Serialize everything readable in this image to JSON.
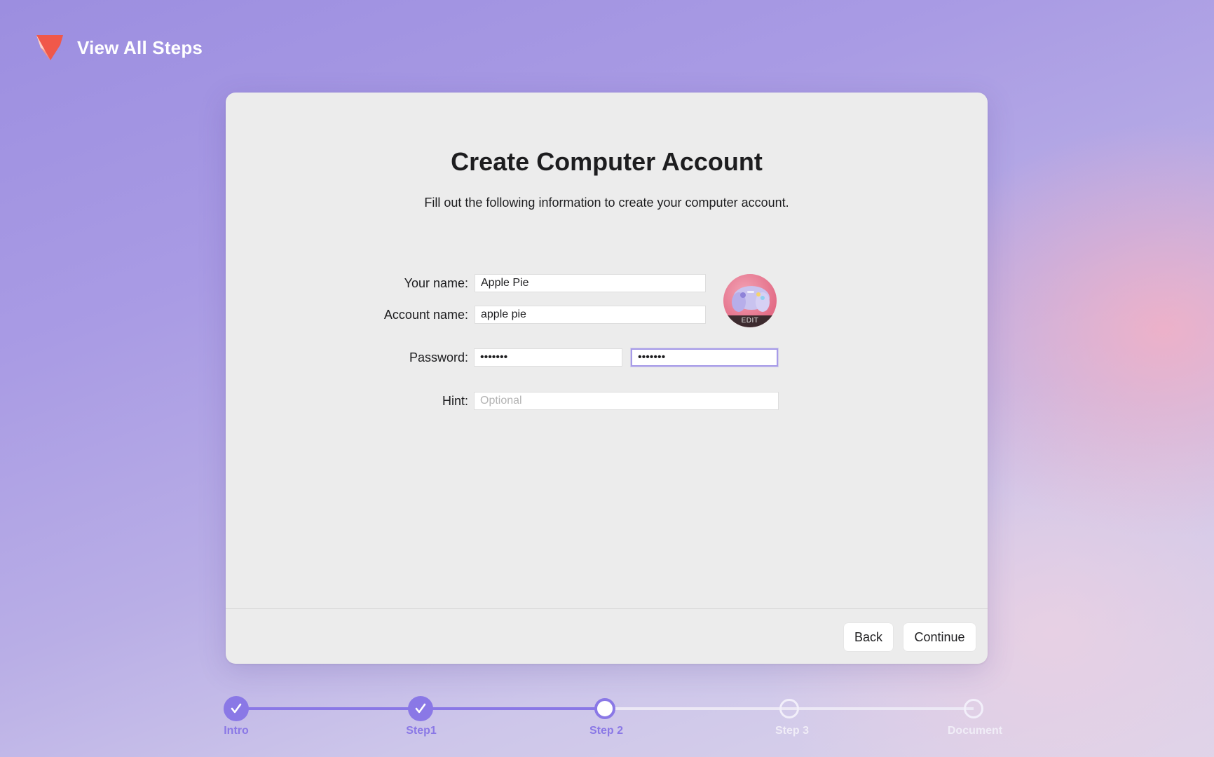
{
  "header": {
    "title": "View All Steps",
    "logo_icon": "folded-ribbon-logo-icon",
    "logo_color": "#f0584a"
  },
  "dialog": {
    "title": "Create Computer Account",
    "subtitle": "Fill out the following information to create your computer account.",
    "fields": {
      "your_name": {
        "label": "Your name:",
        "value": "Apple Pie"
      },
      "account_name": {
        "label": "Account name:",
        "value": "apple pie"
      },
      "password": {
        "label": "Password:",
        "value": "•••••••"
      },
      "password_verify": {
        "value": "•••••••"
      },
      "hint": {
        "label": "Hint:",
        "value": "",
        "placeholder": "Optional"
      }
    },
    "avatar": {
      "edit_label": "EDIT",
      "icon": "game-controller-avatar-icon"
    },
    "buttons": {
      "back": "Back",
      "continue": "Continue"
    }
  },
  "stepper": {
    "accent_color": "#8a78e6",
    "steps": [
      {
        "label": "Intro",
        "state": "complete"
      },
      {
        "label": "Step1",
        "state": "complete"
      },
      {
        "label": "Step 2",
        "state": "current"
      },
      {
        "label": "Step 3",
        "state": "upcoming"
      },
      {
        "label": "Document",
        "state": "upcoming"
      }
    ]
  }
}
